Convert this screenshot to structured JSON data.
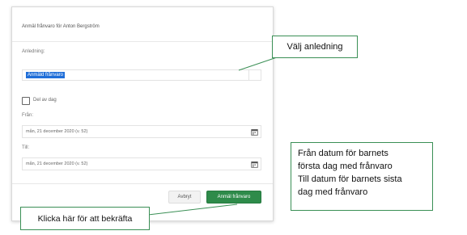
{
  "dialog": {
    "title": "Anmäl frånvaro för Anton Bergström",
    "reason_label": "Anledning:",
    "reason_value": "Anmäld frånvaro",
    "part_of_day_label": "Del av dag",
    "part_of_day_checked": false,
    "from_label": "Från:",
    "from_value": "mån, 21 december 2020 (v. 52)",
    "to_label": "Till:",
    "to_value": "mån, 21 december 2020 (v. 52)",
    "cancel_label": "Avbryt",
    "submit_label": "Anmäl frånvaro"
  },
  "callouts": {
    "reason": "Välj anledning",
    "confirm": "Klicka här för att bekräfta",
    "dates_line1": "Från datum för barnets",
    "dates_line2": "första dag med frånvaro",
    "dates_line3": "Till datum för barnets sista",
    "dates_line4": "dag med frånvaro"
  },
  "colors": {
    "accent_green": "#2e8b4a",
    "callout_border": "#3a8f55",
    "selection_blue": "#1f6ed8"
  },
  "icons": {
    "calendar": "calendar-icon"
  }
}
